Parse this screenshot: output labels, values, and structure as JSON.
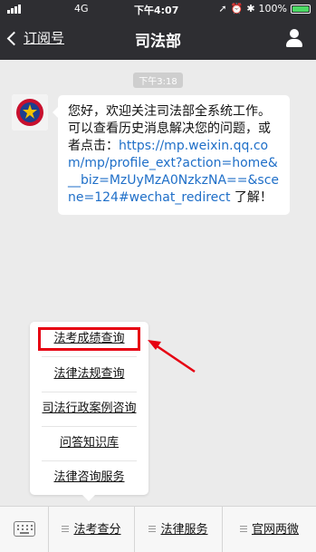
{
  "status_bar": {
    "network": "4G",
    "time": "下午4:07",
    "battery": "100%"
  },
  "nav": {
    "back_label": "订阅号",
    "title": "司法部"
  },
  "chat": {
    "timestamp": "下午3:18",
    "message_intro": "您好，欢迎关注司法部全系统工作。可以查看历史消息解决您的问题，或者点击：",
    "message_link": "https://mp.weixin.qq.com/mp/profile_ext?action=home&__biz=MzUyMzA0NzkzNA==&scene=124#wechat_redirect",
    "message_outro": " 了解！"
  },
  "popup_menu": {
    "items": [
      {
        "label": "法考成绩查询"
      },
      {
        "label": "法律法规查询"
      },
      {
        "label": "司法行政案例咨询"
      },
      {
        "label": "问答知识库"
      },
      {
        "label": "法律咨询服务"
      }
    ]
  },
  "bottom_menu": {
    "tabs": [
      {
        "label": "法考查分"
      },
      {
        "label": "法律服务"
      },
      {
        "label": "官网两微"
      }
    ]
  },
  "colors": {
    "header": "#2e2e32",
    "background": "#ebebeb",
    "link": "#1f6fc8",
    "highlight": "#e60012",
    "battery": "#4cd964"
  }
}
